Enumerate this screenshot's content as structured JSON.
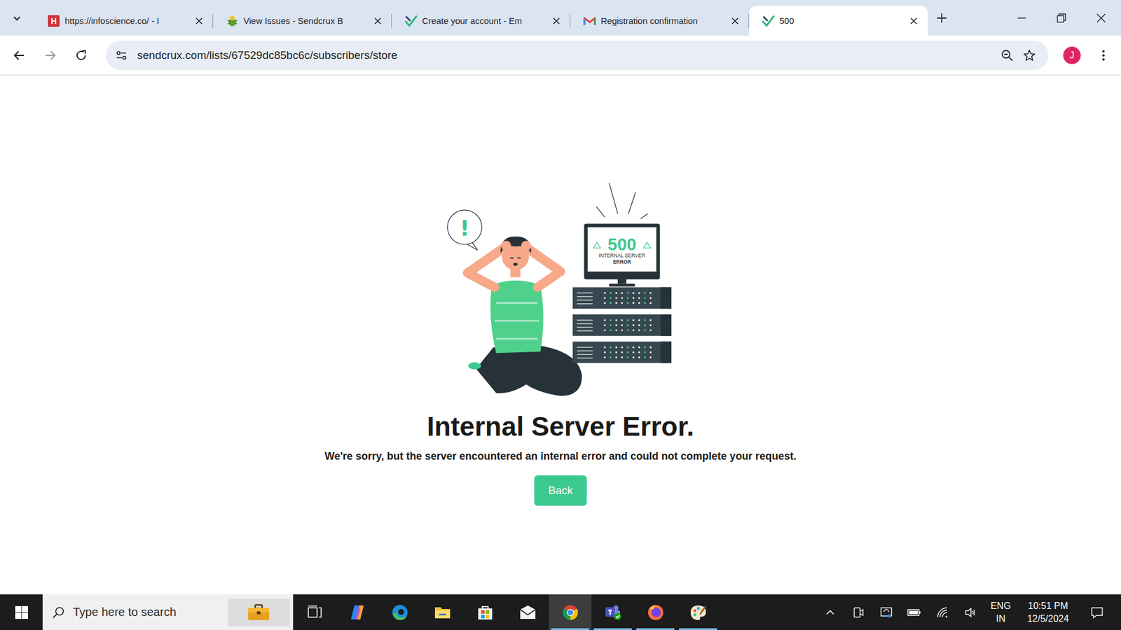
{
  "tabs": [
    {
      "label": "https://infoscience.co/ - I",
      "selected": false,
      "kind": "infoscience",
      "badge": "H"
    },
    {
      "label": "View Issues - Sendcrux B",
      "selected": false,
      "kind": "bug"
    },
    {
      "label": "Create your account - Em",
      "selected": false,
      "kind": "sendcrux"
    },
    {
      "label": "Registration confirmation",
      "selected": false,
      "kind": "gmail"
    },
    {
      "label": "500",
      "selected": true,
      "kind": "sendcrux"
    }
  ],
  "toolbar": {
    "url": "sendcrux.com/lists/67529dc85bc6c/subscribers/store",
    "profile_initial": "J"
  },
  "error_page": {
    "illustration": {
      "alert": "!",
      "code": "500",
      "line1": "INTERNAL SERVER",
      "line2": "ERROR"
    },
    "heading": "Internal Server Error.",
    "message": "We're sorry, but the server encountered an internal error and could not complete your request.",
    "button": "Back"
  },
  "taskbar": {
    "search": {
      "placeholder": "Type here to search"
    },
    "apps": [
      {
        "kind": "task-view",
        "selected": false,
        "running": false
      },
      {
        "kind": "copilot",
        "selected": false,
        "running": false
      },
      {
        "kind": "edge",
        "selected": false,
        "running": false
      },
      {
        "kind": "file-explorer",
        "selected": false,
        "running": false
      },
      {
        "kind": "store",
        "selected": false,
        "running": false
      },
      {
        "kind": "mail",
        "selected": false,
        "running": false
      },
      {
        "kind": "chrome",
        "selected": true,
        "running": true
      },
      {
        "kind": "teams",
        "selected": false,
        "running": true
      },
      {
        "kind": "firefox",
        "selected": false,
        "running": true
      },
      {
        "kind": "paint",
        "selected": false,
        "running": true
      }
    ],
    "tray": {
      "icons": [
        {
          "kind": "chevron"
        },
        {
          "kind": "meet"
        },
        {
          "kind": "sync"
        },
        {
          "kind": "battery"
        },
        {
          "kind": "wifi"
        },
        {
          "kind": "volume"
        }
      ],
      "language": "ENG",
      "region": "IN",
      "time": "10:51 PM",
      "date": "12/5/2024"
    }
  }
}
